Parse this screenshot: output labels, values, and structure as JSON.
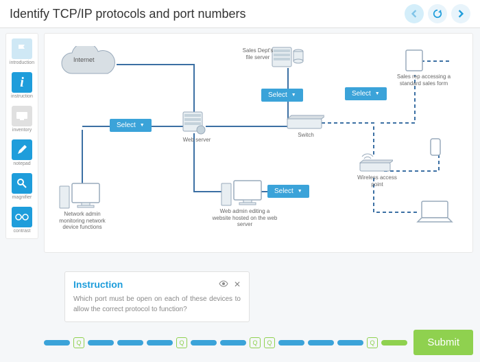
{
  "title": "Identify TCP/IP protocols and port numbers",
  "sidebar": [
    {
      "label": "introduction",
      "cls": "ic-flag"
    },
    {
      "label": "instruction",
      "cls": "ic-info",
      "glyph": "i"
    },
    {
      "label": "inventory",
      "cls": "ic-inv"
    },
    {
      "label": "notepad",
      "cls": "ic-note"
    },
    {
      "label": "magnifier",
      "cls": "ic-mag"
    },
    {
      "label": "contrast",
      "cls": "ic-con"
    }
  ],
  "nodes": {
    "internet": "Internet",
    "sales": "Sales Dept's\nfile server",
    "websrv": "Web server",
    "switch": "Switch",
    "wap": "Wireless\naccess point",
    "rep": "Sales rep accessing\na standard\nsales form",
    "admin": "Network admin\nmonitoring network\ndevice functions",
    "webadm": "Web admin editing\na website hosted\non the web server"
  },
  "select": "Select",
  "instruction": {
    "title": "Instruction",
    "body": "Which port must be open on each of these devices to allow the correct protocol to function?"
  },
  "submit": "Submit"
}
